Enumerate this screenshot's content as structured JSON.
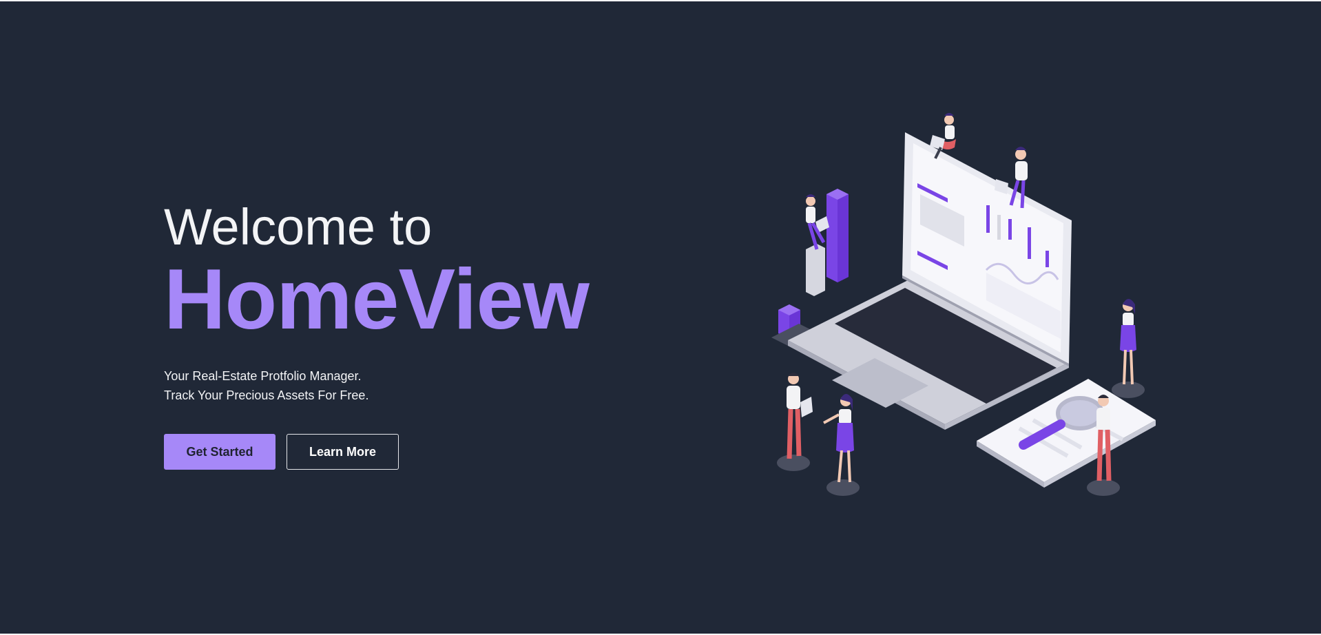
{
  "hero": {
    "welcome": "Welcome to",
    "brand": "HomeView",
    "tagline_line1": "Your Real-Estate Protfolio Manager.",
    "tagline_line2": "Track Your Precious Assets For Free."
  },
  "buttons": {
    "primary_label": "Get Started",
    "secondary_label": "Learn More"
  },
  "colors": {
    "background": "#202837",
    "accent": "#a688f8",
    "text": "#f3f4f6"
  },
  "illustration": {
    "icon": "laptop-analytics-illustration"
  }
}
